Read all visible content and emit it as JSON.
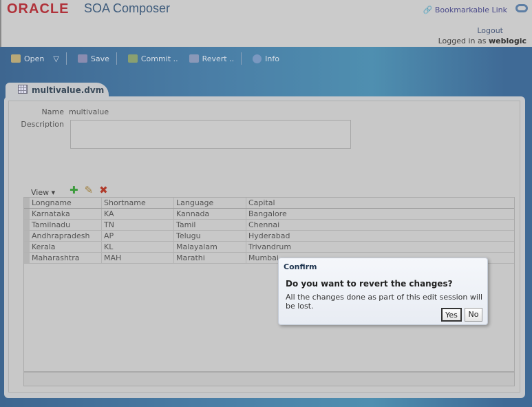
{
  "header": {
    "logo": "ORACLE",
    "app_title": "SOA Composer",
    "bookmarkable_link": "Bookmarkable Link",
    "logout": "Logout",
    "logged_in_prefix": "Logged in as",
    "user": "weblogic"
  },
  "toolbar": {
    "open": "Open",
    "save": "Save",
    "commit": "Commit ..",
    "revert": "Revert ..",
    "info": "Info"
  },
  "tab": {
    "label": "multivalue.dvm"
  },
  "form": {
    "name_label": "Name",
    "name_value": "multivalue",
    "description_label": "Description",
    "description_value": ""
  },
  "table_toolbar": {
    "view": "View"
  },
  "table": {
    "columns": [
      "Longname",
      "Shortname",
      "Language",
      "Capital"
    ],
    "rows": [
      [
        "Karnataka",
        "KA",
        "Kannada",
        "Bangalore"
      ],
      [
        "Tamilnadu",
        "TN",
        "Tamil",
        "Chennai"
      ],
      [
        "Andhrapradesh",
        "AP",
        "Telugu",
        "Hyderabad"
      ],
      [
        "Kerala",
        "KL",
        "Malayalam",
        "Trivandrum"
      ],
      [
        "Maharashtra",
        "MAH",
        "Marathi",
        "Mumbai"
      ]
    ]
  },
  "dialog": {
    "title": "Confirm",
    "question": "Do you want to revert the changes?",
    "message": "All the changes done as part of this edit session will be lost.",
    "yes": "Yes",
    "no": "No"
  }
}
